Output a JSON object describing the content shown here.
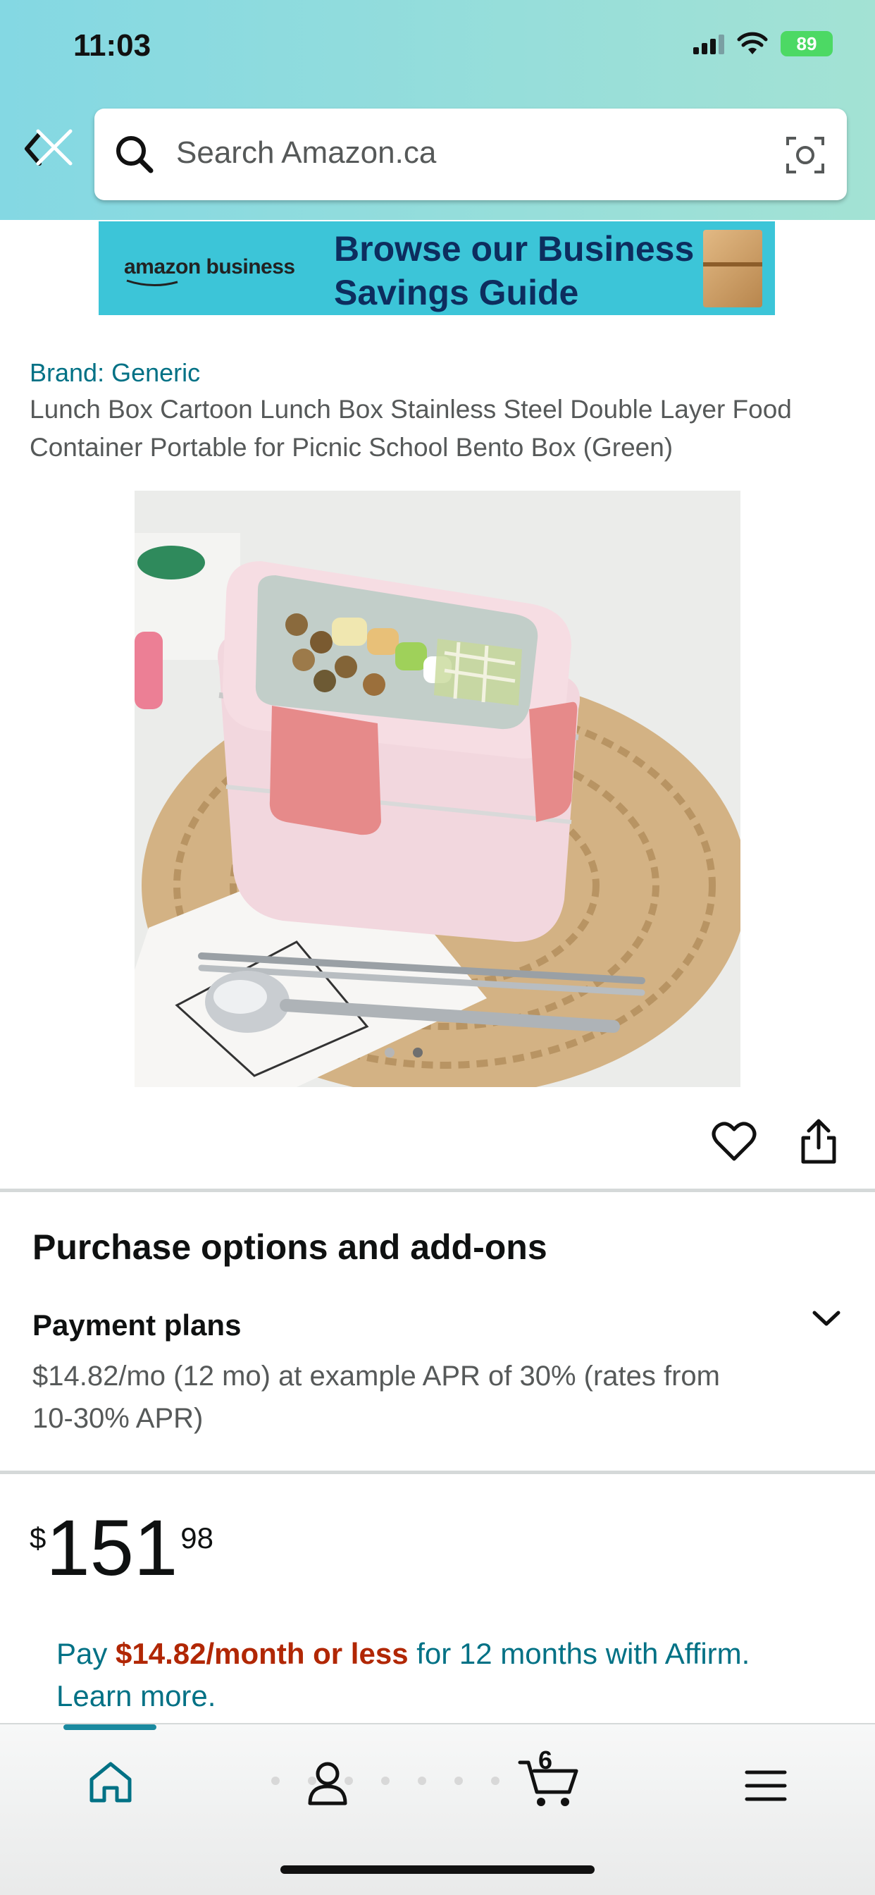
{
  "status_bar": {
    "time": "11:03",
    "battery": "89"
  },
  "search": {
    "placeholder": "Search Amazon.ca"
  },
  "banner": {
    "logo": "amazon business",
    "text": "Browse our Business Savings Guide"
  },
  "product": {
    "brand": "Brand: Generic",
    "title": "Lunch Box Cartoon Lunch Box Stainless Steel Double Layer Food Container Portable for Picnic School Bento Box (Green)",
    "image_count": 2,
    "image_index": 2
  },
  "purchase_options": {
    "heading": "Purchase options and add-ons",
    "payment_plans_title": "Payment plans",
    "payment_plans_text": "$14.82/mo (12 mo) at example APR of 30% (rates from 10-30% APR)"
  },
  "price": {
    "symbol": "$",
    "whole": "151",
    "fraction": "98"
  },
  "affirm": {
    "prefix": "Pay ",
    "highlight": "$14.82/month or less",
    "suffix": " for 12 months with Affirm. Learn more."
  },
  "nav": {
    "cart_count": "6"
  },
  "colors": {
    "link": "#007185",
    "price_highlight": "#b12704",
    "header": "#84d8e3",
    "banner": "#3cc5d8"
  },
  "icons": [
    "back-icon",
    "close-icon",
    "search-icon",
    "camera-icon",
    "heart-icon",
    "share-icon",
    "chevron-down-icon",
    "home-icon",
    "account-icon",
    "cart-icon",
    "menu-icon"
  ]
}
